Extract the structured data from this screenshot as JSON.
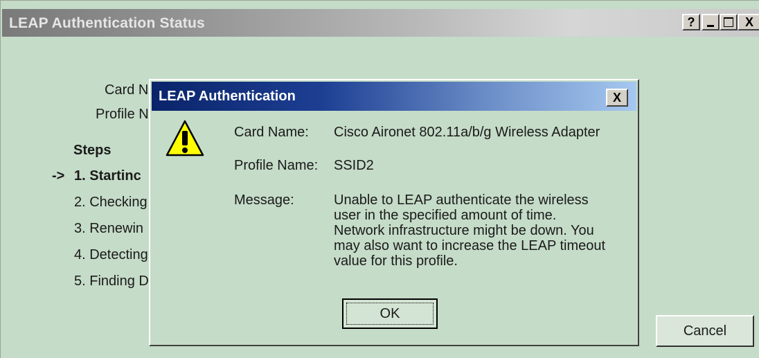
{
  "outer_window": {
    "title": "LEAP Authentication Status",
    "title_buttons": {
      "help": "?",
      "minimize": "_",
      "maximize": "□",
      "close": "X"
    },
    "card_label": "Card N",
    "profile_label": "Profile N",
    "steps_heading": "Steps",
    "current_arrow": "->",
    "steps": [
      "1. Startinc",
      "2. Checking",
      "3. Renewin",
      "4. Detecting",
      "5. Finding D"
    ],
    "cancel_label": "Cancel"
  },
  "dialog": {
    "title": "LEAP Authentication",
    "close_glyph": "X",
    "icon": "warning-icon",
    "card_name_label": "Card Name:",
    "card_name_value": "Cisco Aironet 802.11a/b/g Wireless Adapter",
    "profile_name_label": "Profile Name:",
    "profile_name_value": "SSID2",
    "message_label": "Message:",
    "message_lines": [
      "Unable to LEAP authenticate the wireless",
      "user in the specified  amount of time.",
      "Network infrastructure might be down.  You",
      "may also want to increase the LEAP timeout",
      "value for this profile."
    ],
    "ok_label": "OK"
  },
  "colors": {
    "window_bg": "#c5dcc8",
    "dialog_title_start": "#0a246a",
    "dialog_title_end": "#a6c8f0",
    "warning_fill": "#ffff00"
  }
}
